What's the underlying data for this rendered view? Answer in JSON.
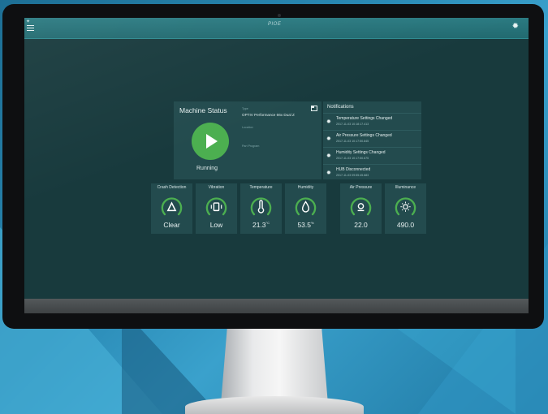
{
  "brand": "PIOE",
  "machine": {
    "title": "Machine Status",
    "status": "Running",
    "type_label": "Type",
    "type_value": "OPTIV Performance 66x Dual Z",
    "location_label": "Location",
    "location_value": "",
    "program_label": "Part Program",
    "program_value": ""
  },
  "notifications": {
    "title": "Notifications",
    "items": [
      {
        "text": "Temperature Settings Changed",
        "date": "2017-11-03 10:18:17.413"
      },
      {
        "text": "Air Pressure Settings Changed",
        "date": "2017-11-03 10:17:50.845"
      },
      {
        "text": "Humidity Settings Changed",
        "date": "2017-11-03 10:17:50.675"
      },
      {
        "text": "HUB Disconnected",
        "date": "2017-11-03 09:55:45.683"
      }
    ]
  },
  "sensors": [
    {
      "label": "Crash Detection",
      "value": "Clear",
      "unit": "",
      "icon": "crash-icon"
    },
    {
      "label": "Vibration",
      "value": "Low",
      "unit": "",
      "icon": "vibration-icon"
    },
    {
      "label": "Temperature",
      "value": "21.3",
      "unit": "°C",
      "icon": "thermometer-icon"
    },
    {
      "label": "Humidity",
      "value": "53.5",
      "unit": "%",
      "icon": "droplet-icon"
    },
    {
      "label": "Air Pressure",
      "value": "22.0",
      "unit": "",
      "icon": "pressure-icon"
    },
    {
      "label": "Illuminance",
      "value": "490.0",
      "unit": "",
      "icon": "sun-icon"
    }
  ],
  "colors": {
    "accent": "#4caf50",
    "panel": "#234b4e",
    "screen": "#183a3d",
    "topbar": "#2b7b82"
  }
}
